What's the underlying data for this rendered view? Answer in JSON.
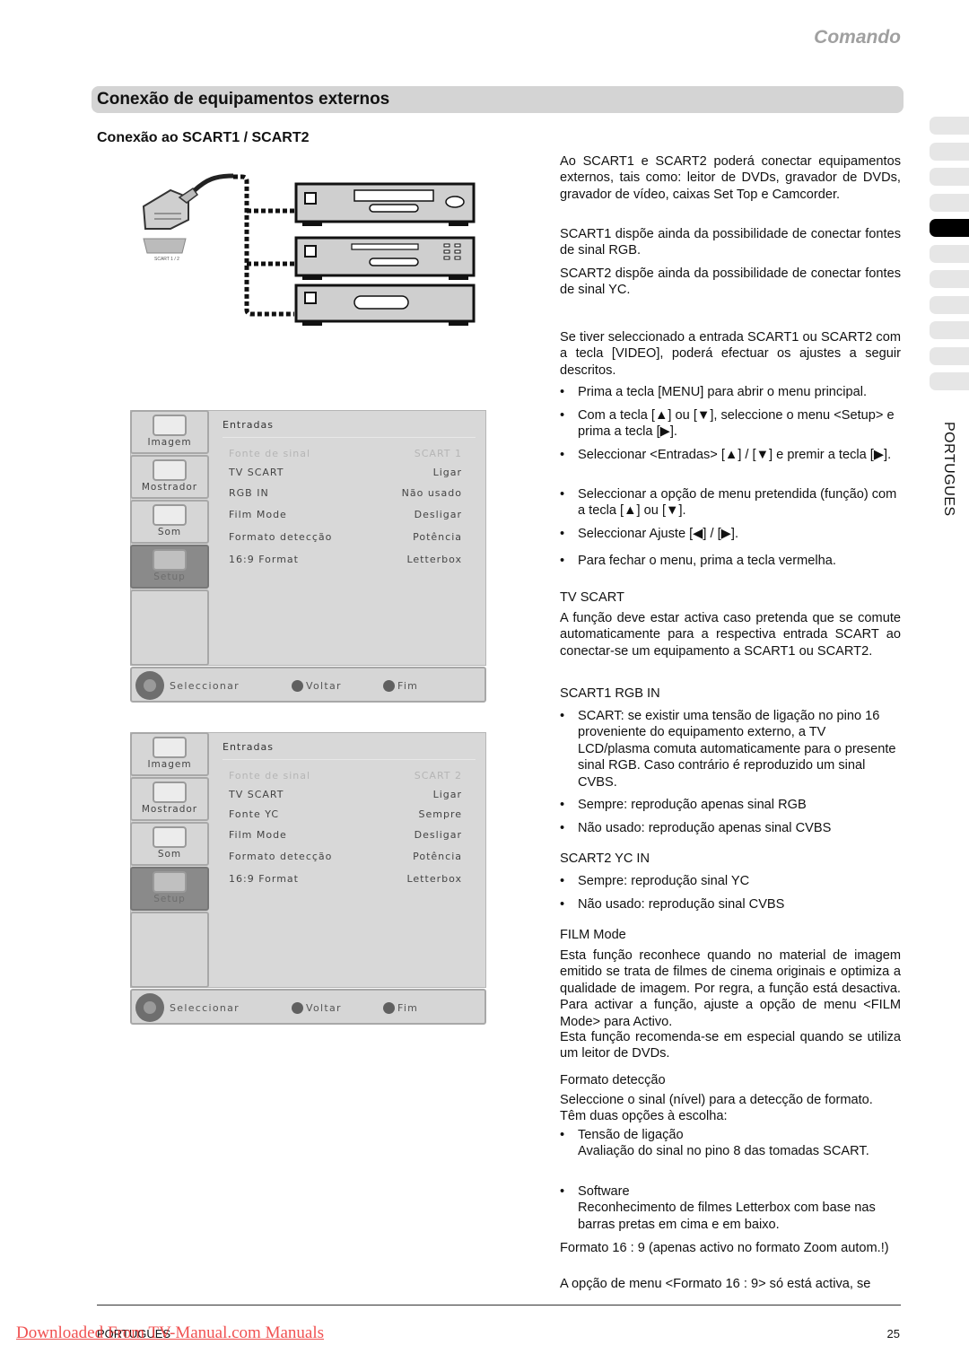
{
  "header": {
    "chapter": "Comando"
  },
  "section": {
    "title": "Conexão de equipamentos externos",
    "subheading": "Conexão ao SCART1 / SCART2"
  },
  "illustration": {
    "connector_label": "SCART 1 / 2"
  },
  "side_tabs": {
    "count": 11,
    "active_index": 4,
    "language": "PORTUGUES"
  },
  "menus": [
    {
      "sidebar": [
        "Imagem",
        "Mostrador",
        "Som",
        "Setup"
      ],
      "active": "Setup",
      "title": "Entradas",
      "rows": [
        {
          "key": "Fonte de sinal",
          "value": "SCART 1",
          "dim": true
        },
        {
          "key": "TV SCART",
          "value": "Ligar"
        },
        {
          "key": "RGB IN",
          "value": "Não usado"
        },
        {
          "key": "Film Mode",
          "value": "Desligar"
        },
        {
          "key": "Formato detecção",
          "value": "Potência"
        },
        {
          "key": "16:9 Format",
          "value": "Letterbox"
        }
      ],
      "footer": {
        "select": "Seleccionar",
        "back": "Voltar",
        "end": "Fim"
      }
    },
    {
      "sidebar": [
        "Imagem",
        "Mostrador",
        "Som",
        "Setup"
      ],
      "active": "Setup",
      "title": "Entradas",
      "rows": [
        {
          "key": "Fonte de sinal",
          "value": "SCART 2",
          "dim": true
        },
        {
          "key": "TV SCART",
          "value": "Ligar"
        },
        {
          "key": "Fonte YC",
          "value": "Sempre"
        },
        {
          "key": "Film Mode",
          "value": "Desligar"
        },
        {
          "key": "Formato detecção",
          "value": "Potência"
        },
        {
          "key": "16:9 Format",
          "value": "Letterbox"
        }
      ],
      "footer": {
        "select": "Seleccionar",
        "back": "Voltar",
        "end": "Fim"
      }
    }
  ],
  "text": {
    "intro1": "Ao SCART1 e SCART2 poderá conectar equipamentos externos, tais como: leitor de DVDs, gravador de DVDs, gravador de vídeo, caixas Set Top e Camcorder.",
    "intro2": "SCART1 dispõe ainda da possibilidade de conectar fontes de sinal RGB.",
    "intro3": "SCART2 dispõe ainda da possibilidade de conectar fontes de sinal YC.",
    "intro4": "Se tiver seleccionado a entrada SCART1 ou SCART2 com a tecla [VIDEO], poderá efectuar os ajustes a seguir descritos.",
    "steps": [
      "Prima a tecla [MENU] para abrir o menu principal.",
      "Com a tecla [▲] ou [▼], seleccione o menu <Setup> e prima a tecla [▶].",
      "Seleccionar <Entradas> [▲] / [▼] e premir a tecla [▶].",
      "Seleccionar a opção de menu pretendida (função) com a tecla [▲] ou [▼].",
      "Seleccionar Ajuste [◀] / [▶].",
      "Para fechar o menu, prima a tecla vermelha."
    ],
    "tvscart_h": "TV SCART",
    "tvscart_p": "A função deve estar activa caso pretenda que se comute automaticamente para a respectiva entrada SCART ao conectar-se um equipamento a SCART1 ou SCART2.",
    "rgb_h": "SCART1 RGB IN",
    "rgb_items": [
      "SCART: se existir uma tensão de ligação no pino 16 proveniente do equipamento externo, a TV LCD/plasma comuta automaticamente para o presente sinal RGB. Caso contrário é reproduzido um sinal CVBS.",
      "Sempre: reprodução apenas sinal RGB",
      "Não usado: reprodução apenas sinal CVBS"
    ],
    "yc_h": "SCART2 YC IN",
    "yc_items": [
      "Sempre: reprodução sinal YC",
      "Não usado: reprodução sinal CVBS"
    ],
    "film_h": "FILM Mode",
    "film_p1": "Esta função reconhece quando no material de imagem emitido se trata de filmes de cinema originais e optimiza a qualidade de imagem. Por regra, a função está desactiva. Para activar a função, ajuste a opção de menu <FILM Mode> para Activo.",
    "film_p2": "Esta função recomenda-se em especial quando se utiliza um leitor de DVDs.",
    "fmt_h": "Formato detecção",
    "fmt_p": "Seleccione o sinal (nível) para a detecção de formato. Têm duas opções à escolha:",
    "fmt_items": [
      {
        "title": "Tensão de ligação",
        "desc": "Avaliação do sinal no pino 8 das tomadas SCART."
      },
      {
        "title": "Software",
        "desc": "Reconhecimento de filmes Letterbox com base nas barras pretas em cima e em baixo."
      }
    ],
    "f169_p": "Formato 16 : 9 (apenas activo no formato Zoom autom.!)",
    "f169_p2": "A opção de menu <Formato 16 : 9> só está activa, se"
  },
  "footer": {
    "language": "PORTUGUES",
    "page": "25",
    "watermark": "Downloaded From TV-Manual.com Manuals"
  }
}
